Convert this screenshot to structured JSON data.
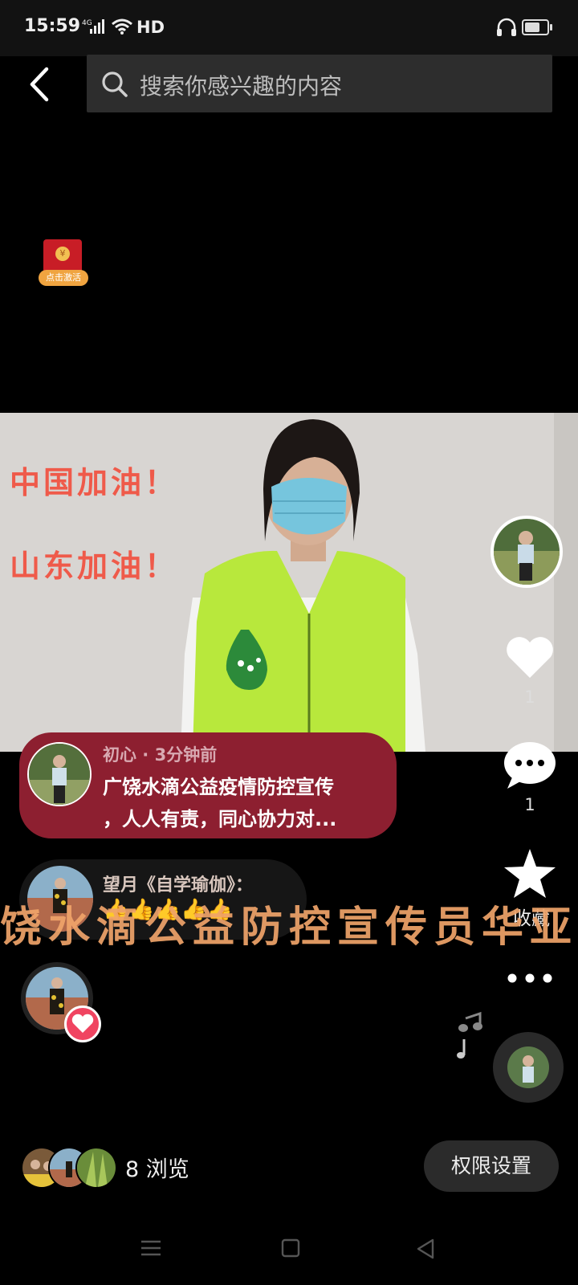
{
  "status_bar": {
    "time": "15:59",
    "network": "4G",
    "hd_label": "HD"
  },
  "search": {
    "placeholder": "搜索你感兴趣的内容"
  },
  "red_packet": {
    "label": "点击激活"
  },
  "video": {
    "caption_line1": "中国加油！",
    "caption_line2": "山东加油！"
  },
  "side_actions": {
    "like_count": "1",
    "comment_count": "1",
    "favorite_label": "收藏"
  },
  "comments": [
    {
      "author_time": "初心 · 3分钟前",
      "line1": "广饶水滴公益疫情防控宣传",
      "line2": "，人人有责，同心协力对..."
    },
    {
      "author": "望月《自学瑜伽》：",
      "text": "👍👍👍👍👍"
    }
  ],
  "scroll_subtitle": "饶水滴公益防控宣传员华亚",
  "footer": {
    "view_count": "8 浏览",
    "permission_label": "权限设置"
  },
  "colors": {
    "comment_highlight": "#8d1f30",
    "like_badge": "#f04461",
    "caption_red": "#ef5a4a"
  }
}
